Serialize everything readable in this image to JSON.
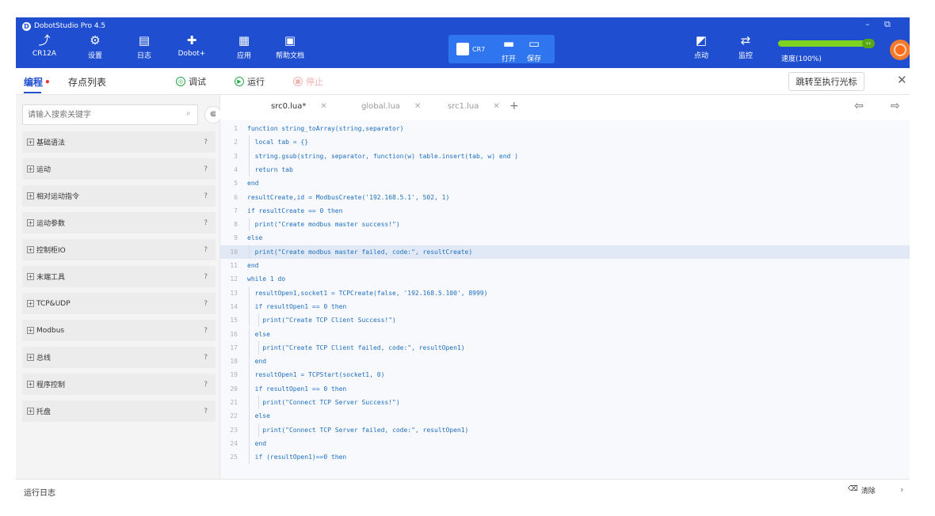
{
  "window": {
    "title": "DobotStudio Pro 4.5",
    "minimize": "–",
    "restore": "⧉"
  },
  "toolbar": {
    "items": [
      {
        "label": "CR12A",
        "icon": "robot-arm-icon",
        "glyph": "⤴"
      },
      {
        "label": "设置",
        "icon": "gear-icon",
        "glyph": "⚙"
      },
      {
        "label": "日志",
        "icon": "log-icon",
        "glyph": "▤"
      },
      {
        "label": "Dobot+",
        "icon": "puzzle-icon",
        "glyph": "✚"
      },
      {
        "label": "应用",
        "icon": "app-icon",
        "glyph": "▦"
      },
      {
        "label": "帮助文档",
        "icon": "help-doc-icon",
        "glyph": "▣"
      }
    ],
    "active_group": {
      "mode": {
        "icon": "code-mode-icon",
        "text": "CR7"
      },
      "open": {
        "label": "打开",
        "icon": "folder-icon",
        "glyph": "▬"
      },
      "save": {
        "label": "保存",
        "icon": "save-icon",
        "glyph": "▭"
      }
    },
    "right": [
      {
        "label": "点动",
        "icon": "jog-icon",
        "glyph": "◩"
      },
      {
        "label": "监控",
        "icon": "monitor-icon",
        "glyph": "⇄"
      }
    ],
    "speed": {
      "label": "速度(100%)",
      "value": 100,
      "knob_text": "‹›",
      "color": "#7ed321"
    },
    "estop_icon": "emergency-stop-icon"
  },
  "subbar": {
    "tabs": [
      {
        "label": "编程",
        "active": true,
        "dot": "•"
      },
      {
        "label": "存点列表",
        "active": false
      }
    ],
    "debug": {
      "label": "调试",
      "glyph": "◎"
    },
    "run": {
      "label": "运行",
      "glyph": "▶"
    },
    "stop": {
      "label": "停止",
      "glyph": "■"
    },
    "jump": "跳转至执行光标",
    "close": "✕"
  },
  "sidebar": {
    "search_placeholder": "请输入搜索关键字",
    "search_icon_glyph": "⌕",
    "collapse_glyph": "⋐",
    "categories": [
      {
        "label": "基础语法"
      },
      {
        "label": "运动"
      },
      {
        "label": "相对运动指令"
      },
      {
        "label": "运动参数"
      },
      {
        "label": "控制柜IO"
      },
      {
        "label": "末端工具"
      },
      {
        "label": "TCP&UDP"
      },
      {
        "label": "Modbus"
      },
      {
        "label": "总线"
      },
      {
        "label": "程序控制"
      },
      {
        "label": "托盘"
      }
    ],
    "help_glyph": "?",
    "plus_glyph": "+"
  },
  "editor": {
    "tabs": [
      {
        "label": "src0.lua*",
        "active": true
      },
      {
        "label": "global.lua",
        "active": false
      },
      {
        "label": "src1.lua",
        "active": false
      }
    ],
    "tab_close": "✕",
    "add_tab": "+",
    "undo_glyph": "⇦",
    "redo_glyph": "⇨",
    "highlighted_line": 10,
    "lines": [
      "function string_toArray(string,separator)",
      "  local tab = {}",
      "  string.gsub(string, separator, function(w) table.insert(tab, w) end )",
      "  return tab",
      "end",
      "resultCreate,id = ModbusCreate('192.168.5.1', 502, 1)",
      "if resultCreate == 0 then",
      "  print(\"Create modbus master success!\")",
      "else",
      "  print(\"Create modbus master failed, code:\", resultCreate)",
      "end",
      "while 1 do",
      "  resultOpen1,socket1 = TCPCreate(false, '192.168.5.100', 8999)",
      "  if resultOpen1 == 0 then",
      "    print(\"Create TCP Client Success!\")",
      "  else",
      "    print(\"Create TCP Client failed, code:\", resultOpen1)",
      "  end",
      "  resultOpen1 = TCPStart(socket1, 0)",
      "  if resultOpen1 == 0 then",
      "    print(\"Connect TCP Server Success!\")",
      "  else",
      "    print(\"Connect TCP Server failed, code:\", resultOpen1)",
      "  end",
      "  if (resultOpen1)==0 then"
    ]
  },
  "statusbar": {
    "title": "运行日志",
    "clear": "清除",
    "clear_glyph": "⌫",
    "chevron": "›"
  }
}
